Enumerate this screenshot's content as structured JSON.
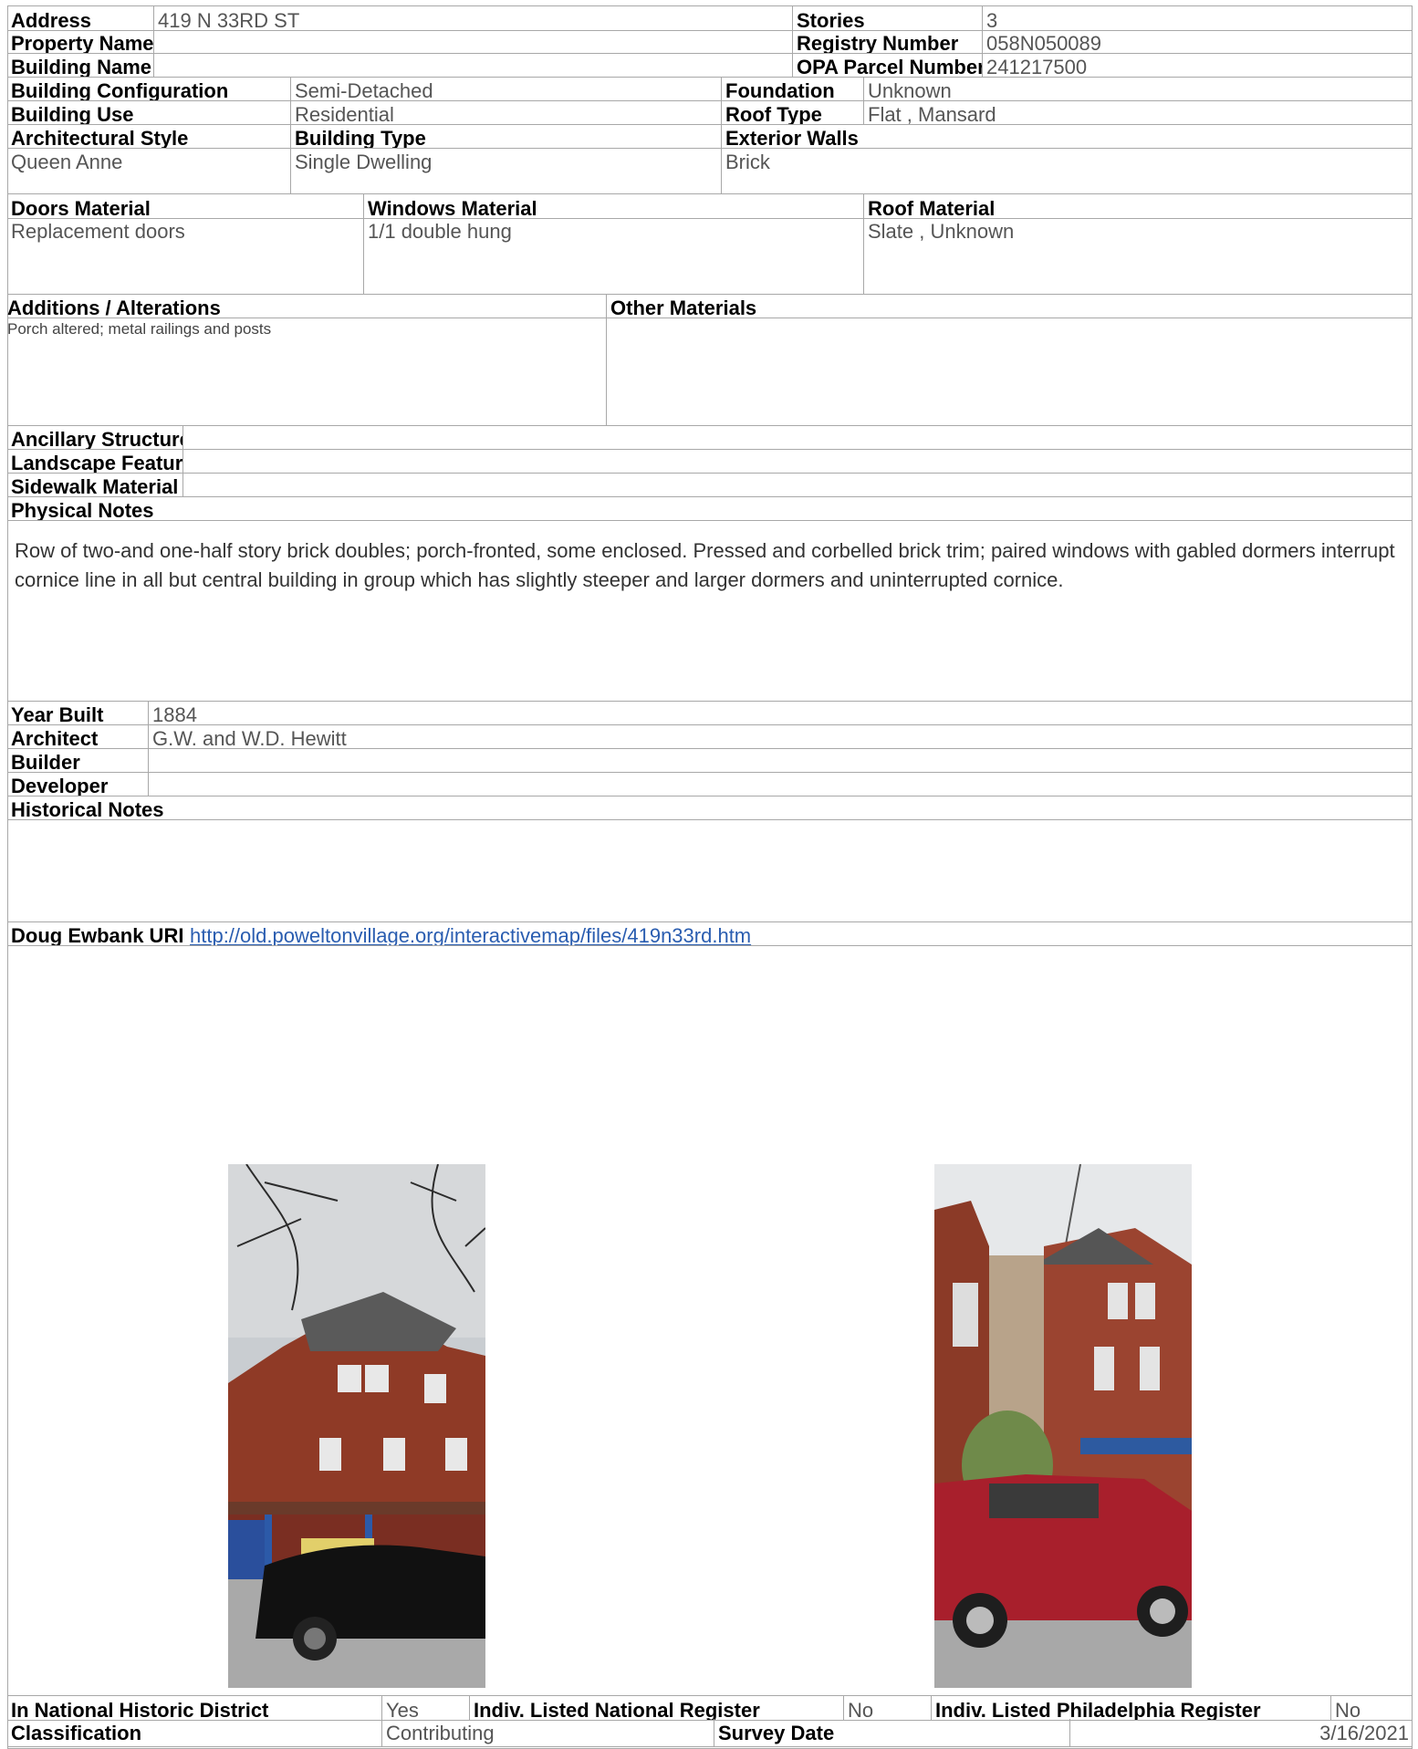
{
  "header": {
    "address_label": "Address",
    "address": "419 N 33RD ST",
    "stories_label": "Stories",
    "stories": "3",
    "property_name_label": "Property Name",
    "property_name": "",
    "registry_label": "Registry Number",
    "registry": "058N050089",
    "building_name_label": "Building Name",
    "building_name": "",
    "opa_label": "OPA Parcel Number",
    "opa": "241217500"
  },
  "config": {
    "configuration_label": "Building Configuration",
    "configuration": "Semi-Detached",
    "foundation_label": "Foundation",
    "foundation": "Unknown",
    "use_label": "Building Use",
    "use": "Residential",
    "roof_type_label": "Roof Type",
    "roof_type": "Flat , Mansard",
    "style_label": "Architectural Style",
    "style": "Queen Anne",
    "type_label": "Building Type",
    "type": "Single Dwelling",
    "walls_label": "Exterior Walls",
    "walls": "Brick"
  },
  "materials": {
    "doors_label": "Doors Material",
    "doors": "Replacement doors",
    "windows_label": "Windows Material",
    "windows": "1/1 double hung",
    "roof_label": "Roof Material",
    "roof": "Slate , Unknown"
  },
  "alterations": {
    "additions_label": "Additions / Alterations",
    "additions": "Porch altered; metal railings and posts",
    "other_label": "Other Materials",
    "other": ""
  },
  "features": {
    "ancillary_label": "Ancillary Structures",
    "ancillary": "",
    "landscape_label": "Landscape Features",
    "landscape": "",
    "sidewalk_label": "Sidewalk Material",
    "sidewalk": ""
  },
  "physical": {
    "label": "Physical Notes",
    "text": "Row of two-and one-half story brick doubles; porch-fronted, some enclosed. Pressed and corbelled brick trim; paired windows with gabled dormers interrupt cornice line in all but central building in group which has slightly steeper and larger dormers and uninterrupted cornice."
  },
  "history": {
    "year_label": "Year Built",
    "year": "1884",
    "architect_label": "Architect",
    "architect": "G.W. and W.D. Hewitt",
    "builder_label": "Builder",
    "builder": "",
    "developer_label": "Developer",
    "developer": "",
    "notes_label": "Historical Notes",
    "notes": ""
  },
  "url": {
    "label": "Doug Ewbank URL",
    "link": "http://old.poweltonvillage.org/interactivemap/files/419n33rd.htm"
  },
  "status": {
    "district_label": "In National Historic District",
    "district": "Yes",
    "national_label": "Indiv. Listed National Register",
    "national": "No",
    "phila_label": "Indiv. Listed Philadelphia Register",
    "phila": "No",
    "classification_label": "Classification",
    "classification": "Contributing",
    "survey_label": "Survey Date",
    "survey": "3/16/2021"
  },
  "colors": {
    "border": "#a8a8a8",
    "link": "#2a5db0",
    "value_text": "#555555"
  }
}
